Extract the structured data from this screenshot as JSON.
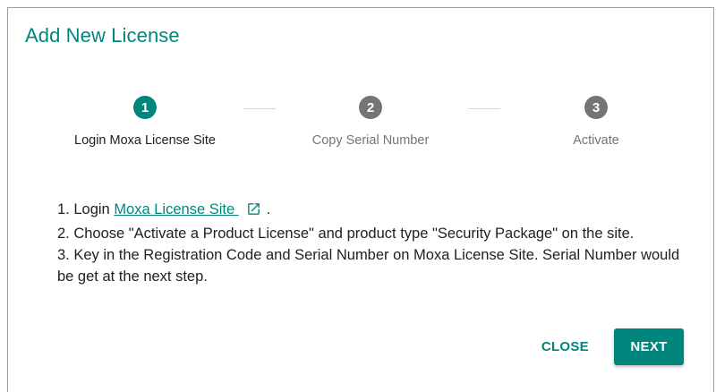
{
  "dialog": {
    "title": "Add New License"
  },
  "stepper": {
    "steps": [
      {
        "number": "1",
        "label": "Login Moxa License Site",
        "state": "active"
      },
      {
        "number": "2",
        "label": "Copy Serial Number",
        "state": "inactive"
      },
      {
        "number": "3",
        "label": "Activate",
        "state": "inactive"
      }
    ]
  },
  "instructions": {
    "line1_prefix": "1. Login ",
    "line1_link": "Moxa License Site ",
    "line1_link_icon": "external-link-icon",
    "line1_suffix": ".",
    "line2": "2. Choose \"Activate a Product License\" and product type \"Security Package\" on the site.",
    "line3": "3. Key in the Registration Code and Serial Number on Moxa License Site. Serial Number would be get at the next step."
  },
  "actions": {
    "close_label": "CLOSE",
    "next_label": "NEXT"
  },
  "colors": {
    "accent": "#00867d",
    "inactive": "#757575"
  }
}
